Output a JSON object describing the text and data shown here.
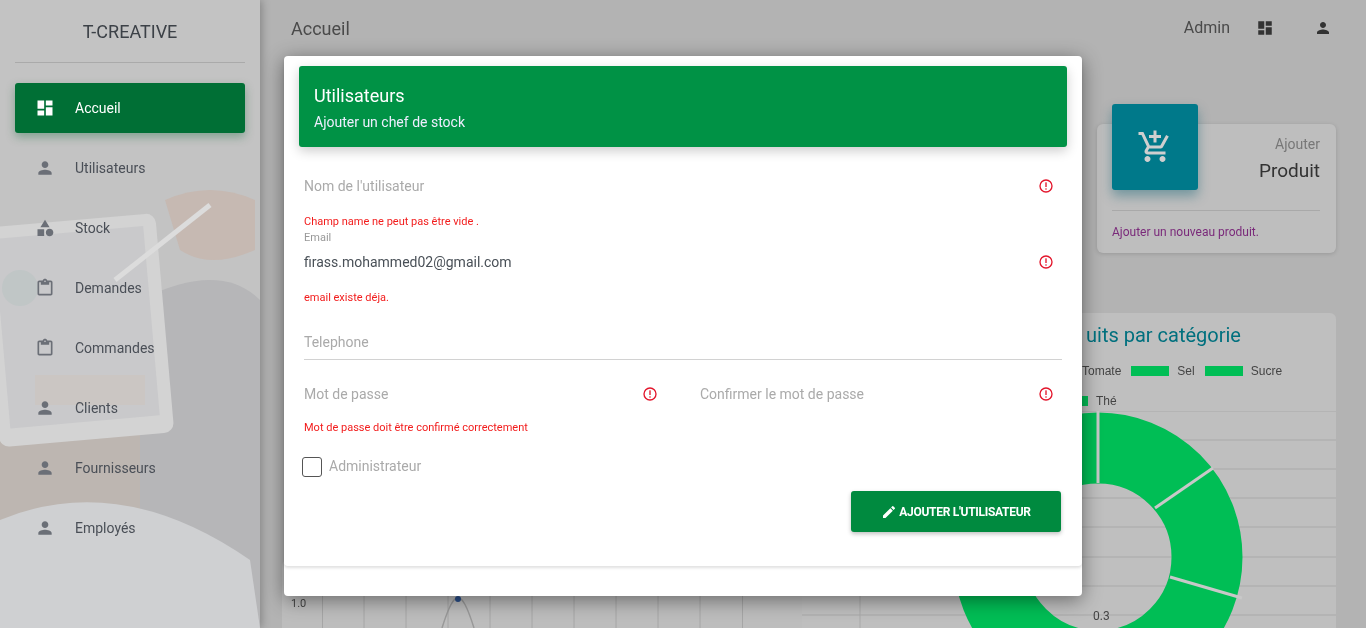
{
  "sidebar": {
    "brand": "T-CREATIVE",
    "items": [
      {
        "label": "Accueil",
        "kind": "dashboard",
        "selected": true
      },
      {
        "label": "Utilisateurs",
        "kind": "person",
        "selected": false
      },
      {
        "label": "Stock",
        "kind": "shapes",
        "selected": false
      },
      {
        "label": "Demandes",
        "kind": "clipboard",
        "selected": false
      },
      {
        "label": "Commandes",
        "kind": "clipboard",
        "selected": false
      },
      {
        "label": "Clients",
        "kind": "person",
        "selected": false
      },
      {
        "label": "Fournisseurs",
        "kind": "person",
        "selected": false
      },
      {
        "label": "Employés",
        "kind": "person",
        "selected": false
      }
    ]
  },
  "header": {
    "title": "Accueil",
    "user": "Admin"
  },
  "product_card": {
    "label": "Ajouter",
    "title": "Produit",
    "footer": "Ajouter un nouveau produit."
  },
  "category_chart": {
    "title": "uits par catégorie",
    "legend": [
      {
        "label": "Tomate",
        "swatch": false
      },
      {
        "label": "Sel",
        "swatch": true
      },
      {
        "label": "Sucre",
        "swatch": true
      },
      {
        "label": "Thé",
        "swatch": true
      }
    ],
    "tick": "0.3"
  },
  "line_chart": {
    "tick": "1.0"
  },
  "dialog": {
    "title": "Utilisateurs",
    "subtitle": "Ajouter un chef de stock",
    "fields": [
      {
        "placeholder": "Nom de l'utilisateur",
        "error": "Champ name ne peut pas être vide ."
      },
      {
        "label": "Email",
        "value": "firass.mohammed02@gmail.com",
        "error": "email existe déja."
      },
      {
        "placeholder": "Telephone"
      }
    ],
    "password_row": {
      "fields": [
        {
          "placeholder": "Mot de passe",
          "invalid": true
        },
        {
          "placeholder": "Confirmer le mot de passe",
          "invalid": true
        }
      ],
      "error": "Mot de passe doit être confirmé correctement"
    },
    "checkbox": {
      "label": "Administrateur",
      "checked": false
    },
    "submit": "AJOUTER L'UTILISATEUR"
  }
}
